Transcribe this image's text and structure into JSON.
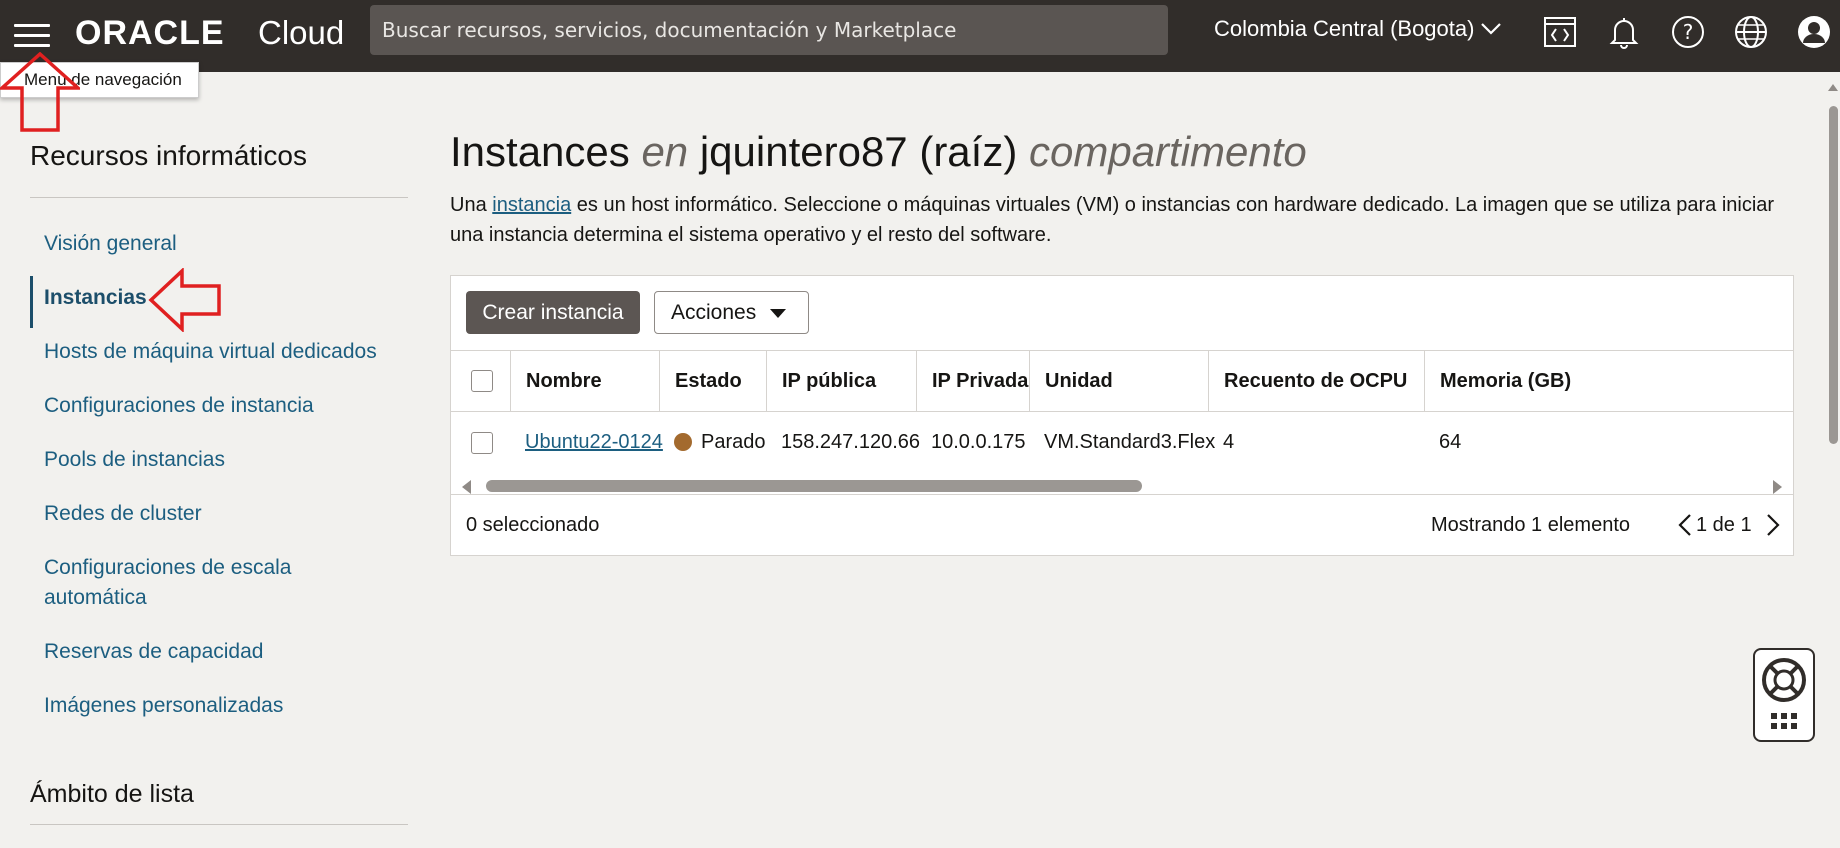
{
  "topbar": {
    "logo_oracle": "ORACLE",
    "logo_cloud": "Cloud",
    "search_placeholder": "Buscar recursos, servicios, documentación y Marketplace",
    "region": "Colombia Central (Bogota)",
    "icons": [
      "hamburger-menu-icon",
      "code-editor-icon",
      "bell-icon",
      "help-icon",
      "globe-icon",
      "user-icon"
    ]
  },
  "tooltip": "Menú de navegación",
  "sidebar": {
    "title": "Recursos informáticos",
    "items": [
      {
        "label": "Visión general"
      },
      {
        "label": "Instancias"
      },
      {
        "label": "Hosts de máquina virtual dedicados"
      },
      {
        "label": "Configuraciones de instancia"
      },
      {
        "label": "Pools de instancias"
      },
      {
        "label": "Redes de cluster"
      },
      {
        "label": "Configuraciones de escala automática"
      },
      {
        "label": "Reservas de capacidad"
      },
      {
        "label": "Imágenes personalizadas"
      }
    ],
    "active_index": 1,
    "scope_title": "Ámbito de lista"
  },
  "main": {
    "title_part1": "Instances",
    "title_en": "en",
    "title_compartment": "jquintero87 (raíz)",
    "title_suffix": "compartimento",
    "desc_before": "Una",
    "desc_link": "instancia",
    "desc_after": "es un host informático. Seleccione o máquinas virtuales (VM) o instancias con hardware dedicado. La imagen que se utiliza para iniciar una instancia determina el sistema operativo y el resto del software.",
    "create_button": "Crear instancia",
    "actions_button": "Acciones",
    "columns": [
      "Nombre",
      "Estado",
      "IP pública",
      "IP Privada",
      "Unidad",
      "Recuento de OCPU",
      "Memoria (GB)"
    ],
    "rows": [
      {
        "name": "Ubuntu22-0124",
        "status": "Parado",
        "public_ip": "158.247.120.66",
        "private_ip": "10.0.0.175",
        "shape": "VM.Standard3.Flex",
        "ocpu": "4",
        "memory": "64"
      }
    ],
    "selected_count": "0 seleccionado",
    "showing": "Mostrando 1 elemento",
    "pager": "1 de 1"
  },
  "colors": {
    "topbar_bg": "#312d2a",
    "link": "#1c5e80",
    "status_stopped": "#a36a2e",
    "primary_button": "#5c5653",
    "annotation_red": "#e02020"
  }
}
